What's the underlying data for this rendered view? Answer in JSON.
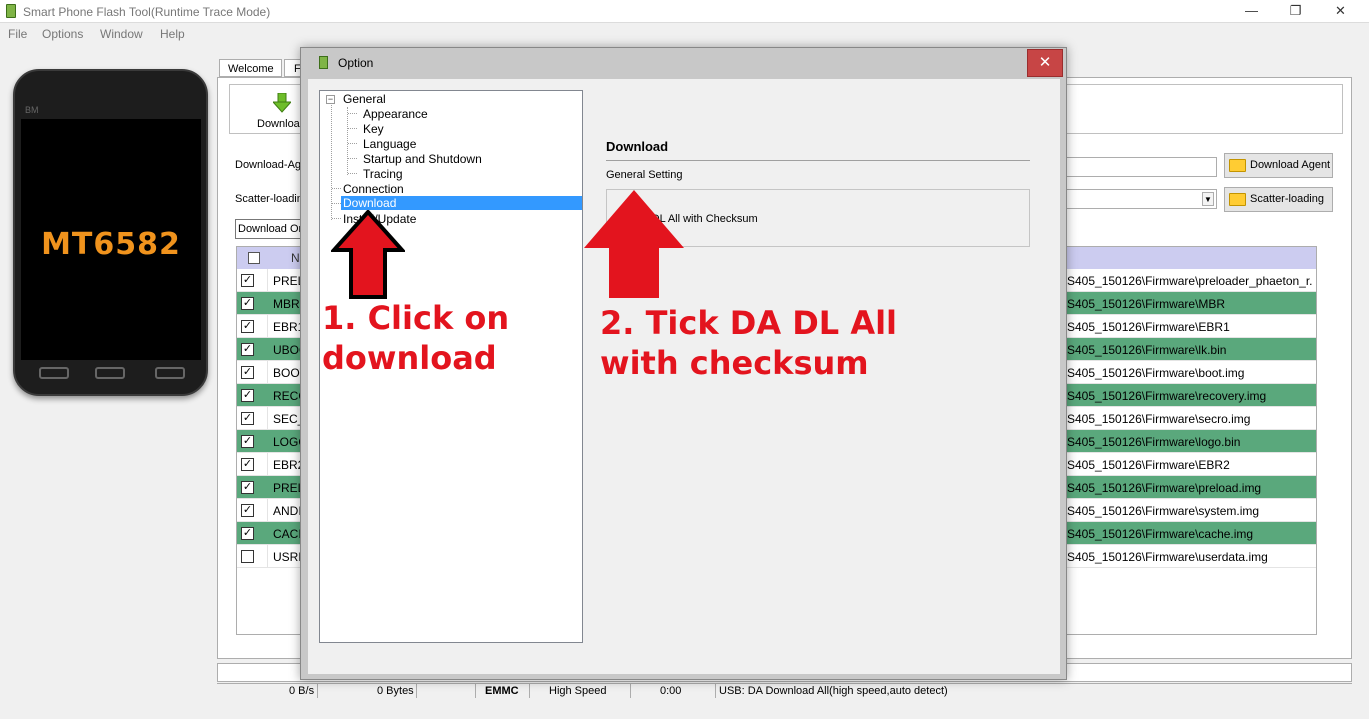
{
  "window": {
    "title": "Smart Phone Flash Tool(Runtime Trace Mode)",
    "controls": {
      "minimize": "—",
      "restore": "❐",
      "close": "✕"
    }
  },
  "menu": [
    "File",
    "Options",
    "Window",
    "Help"
  ],
  "phone": {
    "brand": "BM",
    "model": "MT6582"
  },
  "tabs": [
    "Welcome",
    "F"
  ],
  "toolbar": {
    "download_label": "Downloa"
  },
  "fields": {
    "download_agent_label": "Download-Ag",
    "scatter_label": "Scatter-loadin",
    "download_agent_button": "Download Agent",
    "scatter_button": "Scatter-loading",
    "mode_select": "Download On"
  },
  "table": {
    "header_name": "N",
    "rows": [
      {
        "checked": true,
        "name": "PREL",
        "path": "S405_150126\\Firmware\\preloader_phaeton_r..."
      },
      {
        "checked": true,
        "name": "MBR",
        "path": "S405_150126\\Firmware\\MBR"
      },
      {
        "checked": true,
        "name": "EBR1",
        "path": "S405_150126\\Firmware\\EBR1"
      },
      {
        "checked": true,
        "name": "UBOO",
        "path": "S405_150126\\Firmware\\lk.bin"
      },
      {
        "checked": true,
        "name": "BOOT",
        "path": "S405_150126\\Firmware\\boot.img"
      },
      {
        "checked": true,
        "name": "RECO",
        "path": "S405_150126\\Firmware\\recovery.img"
      },
      {
        "checked": true,
        "name": "SEC_I",
        "path": "S405_150126\\Firmware\\secro.img"
      },
      {
        "checked": true,
        "name": "LOGO",
        "path": "S405_150126\\Firmware\\logo.bin"
      },
      {
        "checked": true,
        "name": "EBR2",
        "path": "S405_150126\\Firmware\\EBR2"
      },
      {
        "checked": true,
        "name": "PREL",
        "path": "S405_150126\\Firmware\\preload.img"
      },
      {
        "checked": true,
        "name": "ANDI",
        "path": "S405_150126\\Firmware\\system.img"
      },
      {
        "checked": true,
        "name": "CACI",
        "path": "S405_150126\\Firmware\\cache.img"
      },
      {
        "checked": false,
        "name": "USRD",
        "path": "S405_150126\\Firmware\\userdata.img"
      }
    ]
  },
  "status": {
    "speed": "0 B/s",
    "bytes": "0 Bytes",
    "storage": "EMMC",
    "usb_speed": "High Speed",
    "time": "0:00",
    "usb_info": "USB: DA Download All(high speed,auto detect)"
  },
  "dialog": {
    "title": "Option",
    "close": "✕",
    "tree": {
      "expander": "−",
      "general": "General",
      "general_children": [
        "Appearance",
        "Key",
        "Language",
        "Startup and Shutdown",
        "Tracing"
      ],
      "connection": "Connection",
      "download": "Download",
      "install": "Install/Update"
    },
    "section_title": "Download",
    "group_label": "General Setting",
    "option_label": "DA DL All with Checksum",
    "option_checked": true
  },
  "annotations": {
    "step1": [
      "1. Click on",
      "download"
    ],
    "step2": [
      "2. Tick DA DL All",
      "with checksum"
    ],
    "color": "#e3141e"
  },
  "colors": {
    "row_highlight": "#5aa87c",
    "table_header": "#ccccf0",
    "selection": "#3399ff",
    "close_button": "#c74545"
  }
}
